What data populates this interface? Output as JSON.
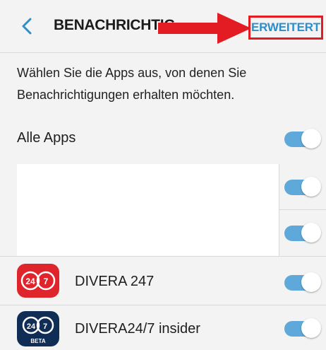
{
  "header": {
    "back_icon": "chevron-left-icon",
    "title": "BENACHRICHTIG",
    "advanced_label": "ERWEITERT",
    "arrow_color": "#e31b23",
    "accent_color": "#2e8ec9"
  },
  "description": "Wählen Sie die Apps aus, von denen Sie Benachrichtigungen erhalten möchten.",
  "all_apps": {
    "label": "Alle Apps",
    "enabled": true
  },
  "hidden_rows": [
    {
      "enabled": true
    },
    {
      "enabled": true
    }
  ],
  "apps": [
    {
      "name": "DIVERA 247",
      "icon": "divera-247-app-icon",
      "icon_color": "#e0242b",
      "icon_text": "24 7",
      "enabled": true
    },
    {
      "name": "DIVERA24/7 insider",
      "icon": "divera-insider-app-icon",
      "icon_color": "#0f2d55",
      "icon_text": "24 7",
      "badge": "BETA",
      "enabled": true
    }
  ],
  "toggle_color": "#5ea9d9"
}
